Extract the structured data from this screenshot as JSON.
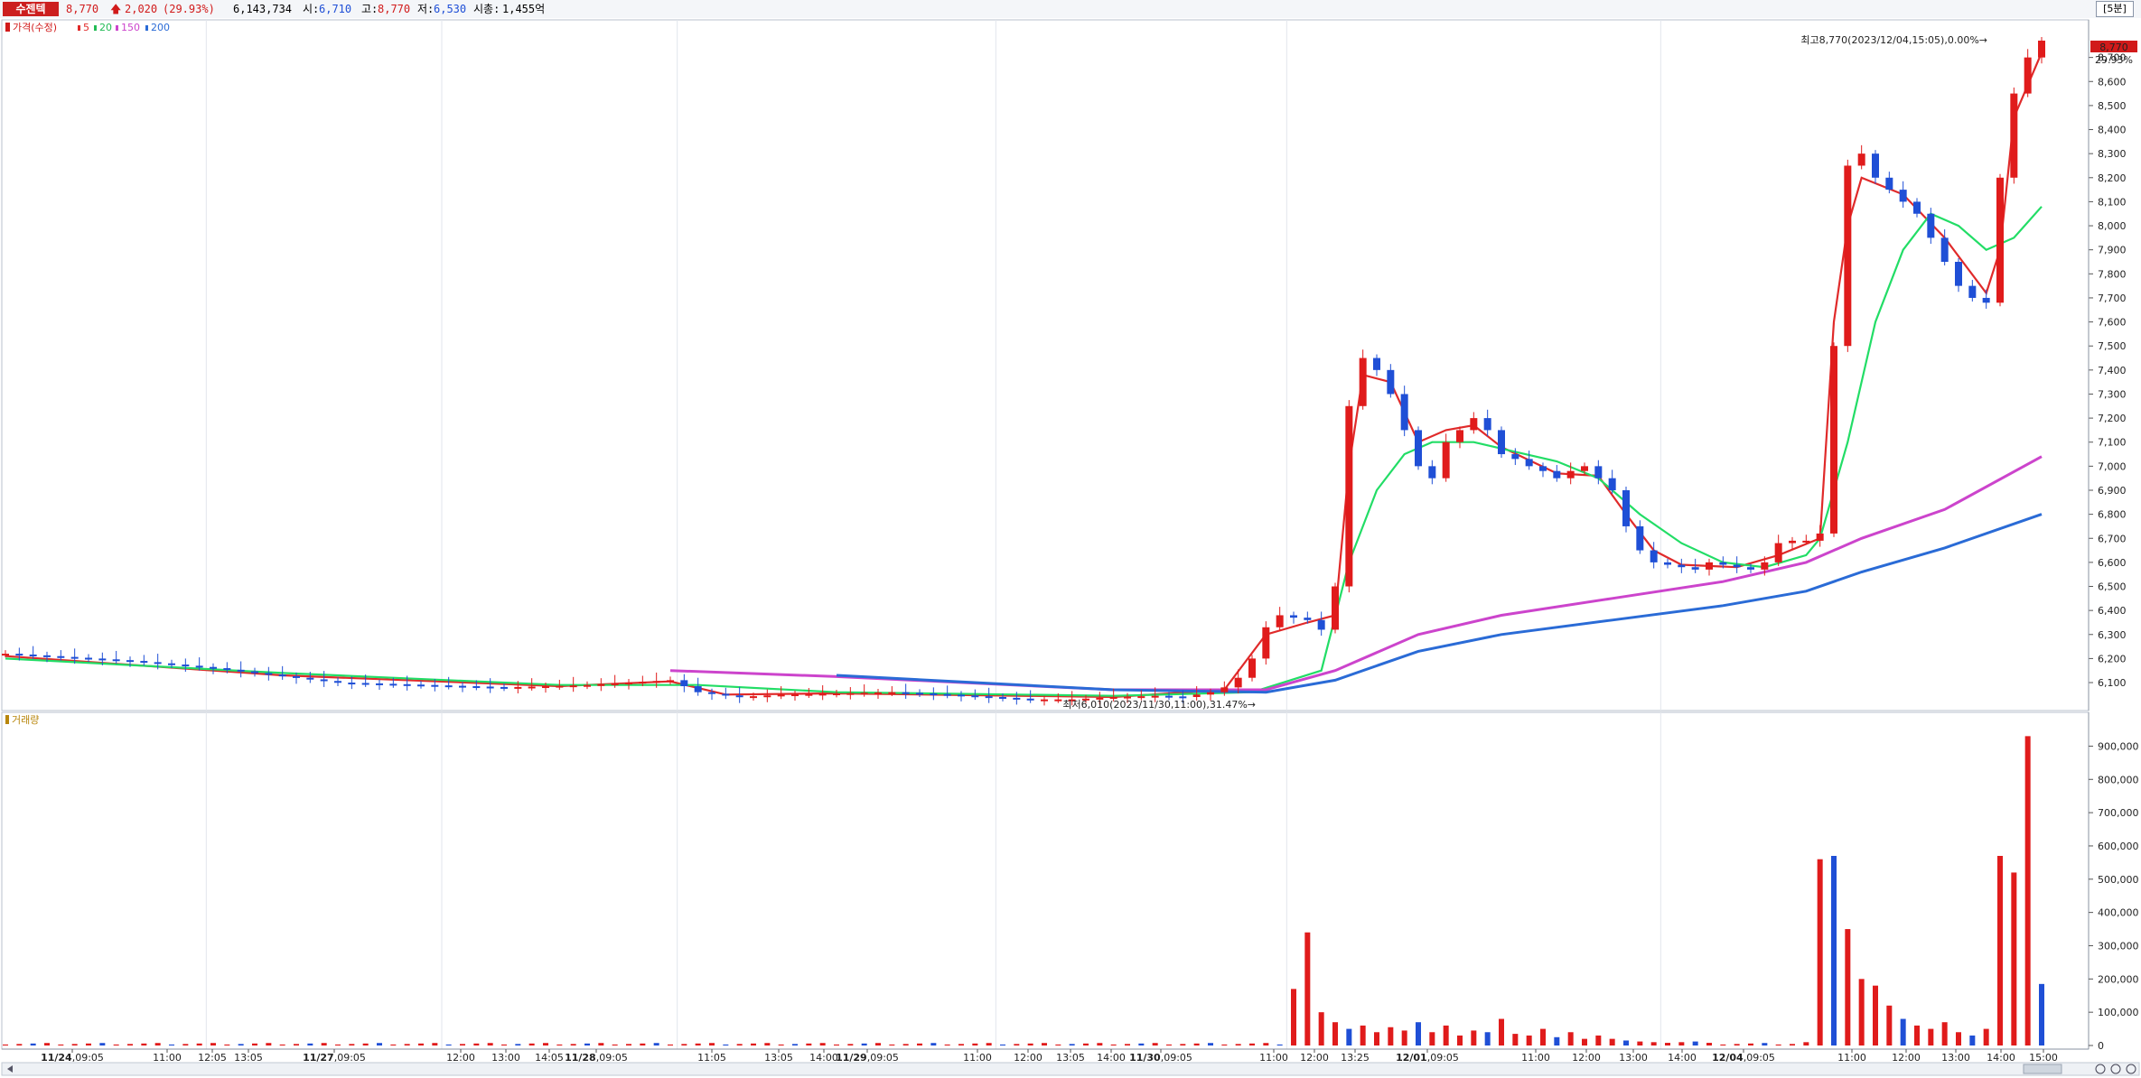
{
  "header": {
    "stock_name": "수젠텍",
    "price": "8,770",
    "change": "2,020",
    "change_pct": "(29.93%)",
    "volume": "6,143,734",
    "open_label": "시:",
    "open": "6,710",
    "high_label": "고:",
    "high": "8,770",
    "low_label": "저:",
    "low": "6,530",
    "mcap_label": "시총:",
    "mcap": "1,455억",
    "interval": "[5분]"
  },
  "colors": {
    "up": "#e01b1b",
    "down": "#1f4fd6",
    "ma5": "#e02a2a",
    "ma20": "#22dd66",
    "ma150": "#cc44cc",
    "ma200": "#2a6bd6",
    "volume_title": "#b8860b"
  },
  "price_panel": {
    "legend_title": "가격(수정)",
    "ma_labels": [
      "5",
      "20",
      "150",
      "200"
    ],
    "y_ticks": [
      "6,100",
      "6,200",
      "6,300",
      "6,400",
      "6,500",
      "6,600",
      "6,700",
      "6,800",
      "6,900",
      "7,000",
      "7,100",
      "7,200",
      "7,300",
      "7,400",
      "7,500",
      "7,600",
      "7,700",
      "7,800",
      "7,900",
      "8,000",
      "8,100",
      "8,200",
      "8,300",
      "8,400",
      "8,500",
      "8,600",
      "8,700"
    ],
    "last_price_tag": "8,770",
    "last_pct_tag": "29.93%",
    "max_annotation": "최고8,770(2023/12/04,15:05),0.00%→",
    "min_annotation": "최저6,010(2023/11/30,11:00),31.47%→"
  },
  "volume_panel": {
    "legend_title": "거래량",
    "y_ticks": [
      "0",
      "100,000",
      "200,000",
      "300,000",
      "400,000",
      "500,000",
      "600,000",
      "700,000",
      "800,000",
      "900,000"
    ]
  },
  "x_labels": [
    {
      "t": "11/24",
      "s": "09:05",
      "bold": true
    },
    {
      "t": "11:00"
    },
    {
      "t": "12:05"
    },
    {
      "t": "13:05"
    },
    {
      "t": "11/27",
      "s": "09:05",
      "bold": true
    },
    {
      "t": "12:00"
    },
    {
      "t": "13:00"
    },
    {
      "t": "14:05"
    },
    {
      "t": "11/28",
      "s": "09:05",
      "bold": true
    },
    {
      "t": "11:05"
    },
    {
      "t": "13:05"
    },
    {
      "t": "14:00"
    },
    {
      "t": "11/29",
      "s": "09:05",
      "bold": true
    },
    {
      "t": "11:00"
    },
    {
      "t": "12:00"
    },
    {
      "t": "13:05"
    },
    {
      "t": "14:00"
    },
    {
      "t": "11/30",
      "s": "09:05",
      "bold": true
    },
    {
      "t": "11:00"
    },
    {
      "t": "12:00"
    },
    {
      "t": "13:25"
    },
    {
      "t": "12/01",
      "s": "09:05",
      "bold": true
    },
    {
      "t": "11:00"
    },
    {
      "t": "12:00"
    },
    {
      "t": "13:00"
    },
    {
      "t": "14:00"
    },
    {
      "t": "12/04",
      "s": "09:05",
      "bold": true
    },
    {
      "t": "11:00"
    },
    {
      "t": "12:00"
    },
    {
      "t": "13:00"
    },
    {
      "t": "14:00"
    },
    {
      "t": "15:00"
    }
  ],
  "chart_data": {
    "type": "candlestick",
    "title": "수젠텍",
    "interval": "5분",
    "price_unit": "KRW",
    "ylim_price": [
      6010,
      8770
    ],
    "ylim_volume": [
      0,
      950000
    ],
    "sessions": [
      "11/24",
      "11/27",
      "11/28",
      "11/29",
      "11/30",
      "12/01",
      "12/04"
    ],
    "price_path": [
      [
        0,
        6220
      ],
      [
        3,
        6210
      ],
      [
        6,
        6200
      ],
      [
        9,
        6190
      ],
      [
        12,
        6175
      ],
      [
        15,
        6160
      ],
      [
        18,
        6140
      ],
      [
        21,
        6120
      ],
      [
        24,
        6100
      ],
      [
        27,
        6095
      ],
      [
        30,
        6090
      ],
      [
        33,
        6085
      ],
      [
        36,
        6080
      ],
      [
        39,
        6085
      ],
      [
        42,
        6090
      ],
      [
        45,
        6100
      ],
      [
        48,
        6110
      ],
      [
        50,
        6060
      ],
      [
        53,
        6040
      ],
      [
        56,
        6050
      ],
      [
        60,
        6055
      ],
      [
        64,
        6060
      ],
      [
        68,
        6050
      ],
      [
        71,
        6040
      ],
      [
        74,
        6030
      ],
      [
        77,
        6030
      ],
      [
        80,
        6040
      ],
      [
        83,
        6045
      ],
      [
        85,
        6040
      ],
      [
        87,
        6060
      ],
      [
        88,
        6080
      ],
      [
        89,
        6120
      ],
      [
        90,
        6200
      ],
      [
        91,
        6330
      ],
      [
        92,
        6380
      ],
      [
        93,
        6370
      ],
      [
        94,
        6360
      ],
      [
        95,
        6320
      ],
      [
        96,
        6500
      ],
      [
        97,
        7250
      ],
      [
        98,
        7450
      ],
      [
        99,
        7400
      ],
      [
        100,
        7300
      ],
      [
        101,
        7150
      ],
      [
        102,
        7000
      ],
      [
        103,
        6950
      ],
      [
        104,
        7100
      ],
      [
        105,
        7150
      ],
      [
        106,
        7200
      ],
      [
        107,
        7150
      ],
      [
        108,
        7050
      ],
      [
        109,
        7030
      ],
      [
        110,
        7000
      ],
      [
        111,
        6980
      ],
      [
        112,
        6950
      ],
      [
        113,
        6980
      ],
      [
        114,
        7000
      ],
      [
        115,
        6950
      ],
      [
        116,
        6900
      ],
      [
        117,
        6750
      ],
      [
        118,
        6650
      ],
      [
        119,
        6600
      ],
      [
        120,
        6590
      ],
      [
        121,
        6580
      ],
      [
        122,
        6570
      ],
      [
        123,
        6600
      ],
      [
        124,
        6590
      ],
      [
        125,
        6580
      ],
      [
        126,
        6570
      ],
      [
        127,
        6600
      ],
      [
        128,
        6680
      ],
      [
        129,
        6690
      ],
      [
        130,
        6690
      ],
      [
        131,
        6720
      ],
      [
        132,
        7500
      ],
      [
        133,
        8250
      ],
      [
        134,
        8300
      ],
      [
        135,
        8200
      ],
      [
        136,
        8150
      ],
      [
        137,
        8100
      ],
      [
        138,
        8050
      ],
      [
        139,
        7950
      ],
      [
        140,
        7850
      ],
      [
        141,
        7750
      ],
      [
        142,
        7700
      ],
      [
        143,
        7680
      ],
      [
        144,
        8200
      ],
      [
        145,
        8550
      ],
      [
        146,
        8700
      ],
      [
        147,
        8770
      ]
    ],
    "ma_series": [
      {
        "name": "5",
        "values": [
          [
            0,
            6210
          ],
          [
            20,
            6130
          ],
          [
            40,
            6085
          ],
          [
            48,
            6105
          ],
          [
            52,
            6050
          ],
          [
            60,
            6055
          ],
          [
            80,
            6040
          ],
          [
            88,
            6070
          ],
          [
            91,
            6300
          ],
          [
            94,
            6350
          ],
          [
            96,
            6380
          ],
          [
            97,
            7000
          ],
          [
            98,
            7380
          ],
          [
            100,
            7350
          ],
          [
            102,
            7100
          ],
          [
            104,
            7150
          ],
          [
            106,
            7170
          ],
          [
            108,
            7080
          ],
          [
            112,
            6970
          ],
          [
            115,
            6960
          ],
          [
            117,
            6800
          ],
          [
            119,
            6650
          ],
          [
            121,
            6590
          ],
          [
            125,
            6580
          ],
          [
            128,
            6630
          ],
          [
            131,
            6700
          ],
          [
            132,
            7600
          ],
          [
            133,
            8000
          ],
          [
            134,
            8200
          ],
          [
            137,
            8130
          ],
          [
            140,
            7950
          ],
          [
            143,
            7720
          ],
          [
            144,
            7900
          ],
          [
            145,
            8450
          ],
          [
            147,
            8720
          ]
        ]
      },
      {
        "name": "20",
        "values": [
          [
            0,
            6200
          ],
          [
            20,
            6140
          ],
          [
            40,
            6090
          ],
          [
            50,
            6090
          ],
          [
            60,
            6060
          ],
          [
            80,
            6045
          ],
          [
            90,
            6060
          ],
          [
            95,
            6150
          ],
          [
            97,
            6600
          ],
          [
            99,
            6900
          ],
          [
            101,
            7050
          ],
          [
            103,
            7100
          ],
          [
            106,
            7100
          ],
          [
            109,
            7060
          ],
          [
            112,
            7020
          ],
          [
            115,
            6950
          ],
          [
            118,
            6800
          ],
          [
            121,
            6680
          ],
          [
            124,
            6600
          ],
          [
            127,
            6580
          ],
          [
            130,
            6630
          ],
          [
            131,
            6700
          ],
          [
            133,
            7100
          ],
          [
            135,
            7600
          ],
          [
            137,
            7900
          ],
          [
            139,
            8050
          ],
          [
            141,
            8000
          ],
          [
            143,
            7900
          ],
          [
            145,
            7950
          ],
          [
            147,
            8080
          ]
        ]
      },
      {
        "name": "150",
        "values": [
          [
            48,
            6150
          ],
          [
            60,
            6125
          ],
          [
            80,
            6070
          ],
          [
            91,
            6070
          ],
          [
            96,
            6150
          ],
          [
            102,
            6300
          ],
          [
            108,
            6380
          ],
          [
            116,
            6450
          ],
          [
            124,
            6520
          ],
          [
            130,
            6600
          ],
          [
            134,
            6700
          ],
          [
            140,
            6820
          ],
          [
            147,
            7040
          ]
        ]
      },
      {
        "name": "200",
        "values": [
          [
            60,
            6130
          ],
          [
            80,
            6070
          ],
          [
            91,
            6060
          ],
          [
            96,
            6110
          ],
          [
            102,
            6230
          ],
          [
            108,
            6300
          ],
          [
            116,
            6360
          ],
          [
            124,
            6420
          ],
          [
            130,
            6480
          ],
          [
            134,
            6560
          ],
          [
            140,
            6660
          ],
          [
            147,
            6800
          ]
        ]
      }
    ],
    "volume_bars": [
      [
        93,
        170000
      ],
      [
        94,
        340000
      ],
      [
        95,
        100000
      ],
      [
        96,
        70000
      ],
      [
        97,
        50000
      ],
      [
        98,
        60000
      ],
      [
        99,
        40000
      ],
      [
        100,
        55000
      ],
      [
        101,
        45000
      ],
      [
        102,
        70000
      ],
      [
        103,
        40000
      ],
      [
        104,
        60000
      ],
      [
        105,
        30000
      ],
      [
        106,
        45000
      ],
      [
        107,
        40000
      ],
      [
        108,
        80000
      ],
      [
        109,
        35000
      ],
      [
        110,
        30000
      ],
      [
        111,
        50000
      ],
      [
        112,
        25000
      ],
      [
        113,
        40000
      ],
      [
        114,
        20000
      ],
      [
        115,
        30000
      ],
      [
        116,
        20000
      ],
      [
        117,
        15000
      ],
      [
        118,
        12000
      ],
      [
        119,
        10000
      ],
      [
        120,
        8000
      ],
      [
        121,
        10000
      ],
      [
        122,
        12000
      ],
      [
        123,
        8000
      ],
      [
        130,
        10000
      ],
      [
        131,
        560000
      ],
      [
        132,
        570000
      ],
      [
        133,
        350000
      ],
      [
        134,
        200000
      ],
      [
        135,
        180000
      ],
      [
        136,
        120000
      ],
      [
        137,
        80000
      ],
      [
        138,
        60000
      ],
      [
        139,
        50000
      ],
      [
        140,
        70000
      ],
      [
        141,
        40000
      ],
      [
        142,
        30000
      ],
      [
        143,
        50000
      ],
      [
        144,
        570000
      ],
      [
        145,
        520000
      ],
      [
        146,
        930000
      ],
      [
        147,
        185000
      ]
    ]
  }
}
